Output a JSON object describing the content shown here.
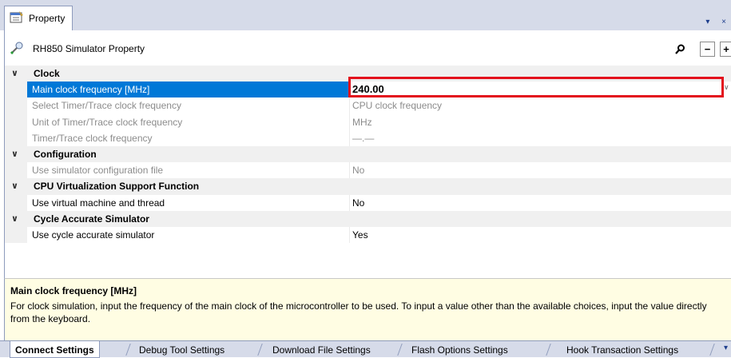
{
  "window": {
    "tab_label": "Property",
    "panel_controls": "▾ ×"
  },
  "header": {
    "title": "RH850 Simulator Property",
    "search_icon": "search-icon",
    "collapse_label": "−",
    "expand_label": "+"
  },
  "grid": {
    "categories": [
      {
        "name": "Clock",
        "items": [
          {
            "name": "Main clock frequency [MHz]",
            "value": "240.00",
            "selected": true
          },
          {
            "name": "Select Timer/Trace clock frequency",
            "value": "CPU clock frequency",
            "dim": true
          },
          {
            "name": "Unit of Timer/Trace clock frequency",
            "value": "MHz",
            "dim": true
          },
          {
            "name": "Timer/Trace clock frequency",
            "value": "—.—",
            "dim": true
          }
        ]
      },
      {
        "name": "Configuration",
        "items": [
          {
            "name": "Use simulator configuration file",
            "value": "No",
            "dim": true
          }
        ]
      },
      {
        "name": "CPU Virtualization Support Function",
        "items": [
          {
            "name": "Use virtual machine and thread",
            "value": "No"
          }
        ]
      },
      {
        "name": "Cycle Accurate Simulator",
        "items": [
          {
            "name": "Use cycle accurate simulator",
            "value": "Yes"
          }
        ]
      }
    ]
  },
  "description": {
    "title": "Main clock frequency [MHz]",
    "text": "For clock simulation, input the frequency of the main clock of the microcontroller to be used. To input a value other than the available choices, input the value directly from the keyboard."
  },
  "bottom_tabs": [
    "Connect Settings",
    "Debug Tool Settings",
    "Download File Settings",
    "Flash Options Settings",
    "Hook Transaction Settings"
  ],
  "colors": {
    "selection": "#0078d7",
    "highlight_border": "#e3111d",
    "description_bg": "#fffde3"
  }
}
